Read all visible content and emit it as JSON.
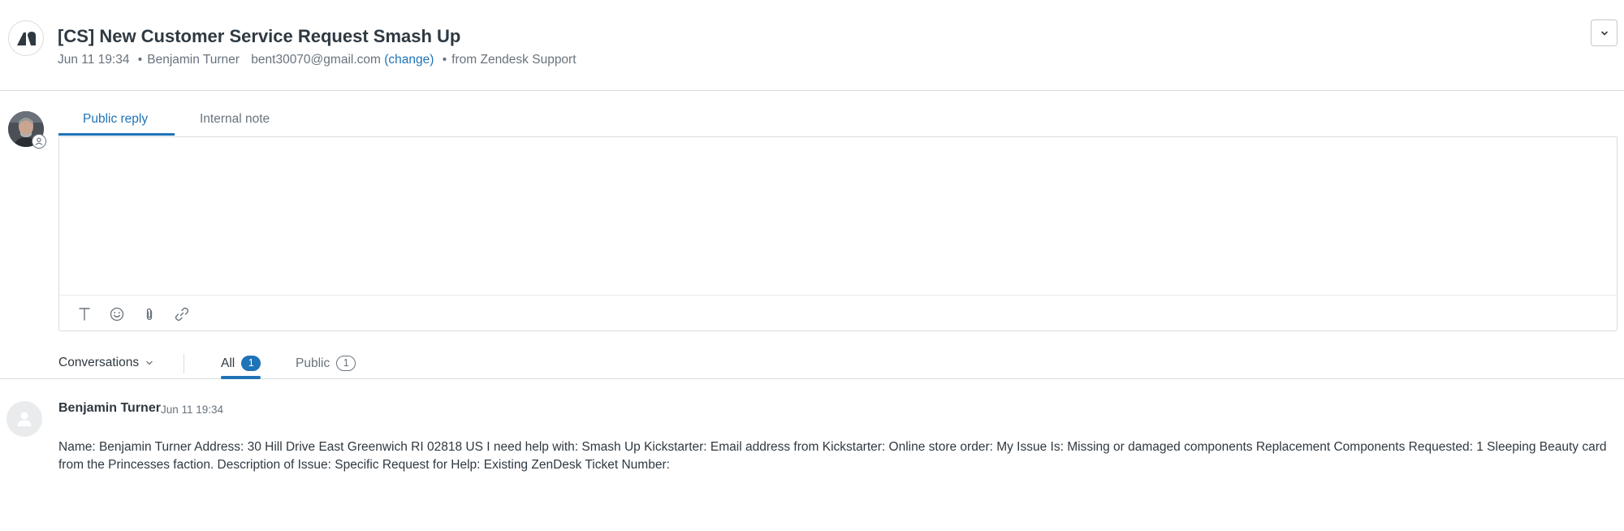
{
  "ticket": {
    "title": "[CS] New Customer Service Request Smash Up",
    "date": "Jun 11 19:34",
    "requester": "Benjamin Turner",
    "email": "bent30070@gmail.com",
    "change_label": "(change)",
    "source": "from Zendesk Support",
    "separator": "•"
  },
  "composer": {
    "tabs": [
      {
        "label": "Public reply",
        "active": true
      },
      {
        "label": "Internal note",
        "active": false
      }
    ],
    "toolbar_icons": [
      "text-format-icon",
      "emoji-icon",
      "attachment-icon",
      "link-icon"
    ]
  },
  "conversation_filters": {
    "dropdown_label": "Conversations",
    "tabs": [
      {
        "label": "All",
        "count": "1",
        "active": true
      },
      {
        "label": "Public",
        "count": "1",
        "active": false
      }
    ]
  },
  "messages": [
    {
      "author": "Benjamin Turner",
      "time": "Jun 11 19:34",
      "body": "Name: Benjamin Turner Address: 30 Hill Drive East Greenwich RI 02818 US I need help with: Smash Up Kickstarter: Email address from Kickstarter: Online store order: My Issue Is: Missing or damaged components Replacement Components Requested: 1 Sleeping Beauty card from the Princesses faction. Description of Issue: Specific Request for Help: Existing ZenDesk Ticket Number:"
    }
  ],
  "colors": {
    "accent": "#1f73b7",
    "text": "#2f3941",
    "muted": "#68737d",
    "border": "#d8dcde"
  }
}
